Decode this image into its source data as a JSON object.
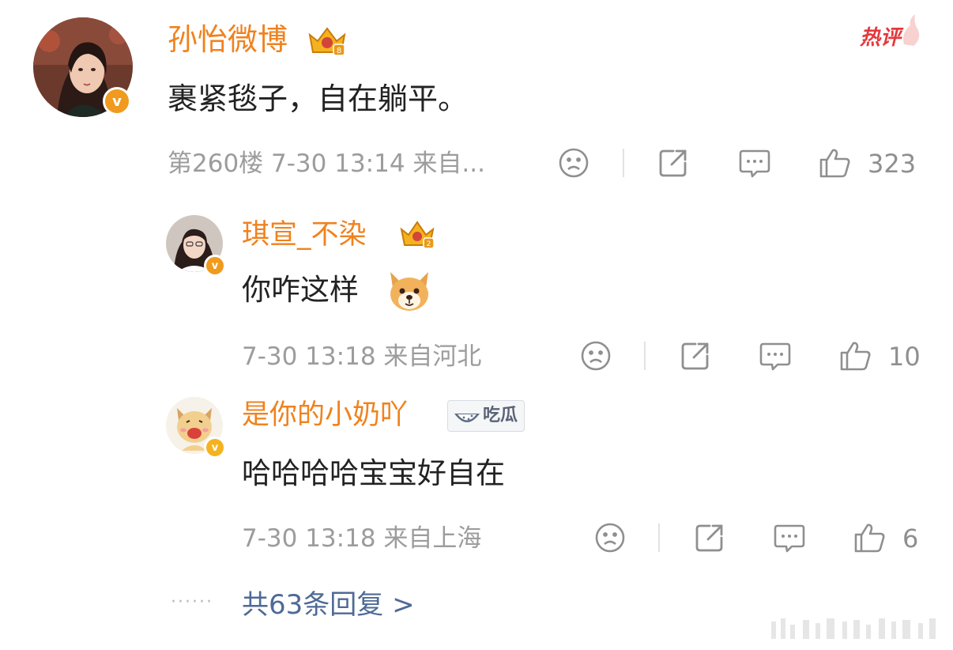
{
  "comment": {
    "author": "孙怡微博",
    "text": "裹紧毯子，自在躺平。",
    "meta": "第260楼 7-30 13:14 来自...",
    "likes": "323",
    "hot_label": "热评",
    "icons": [
      "crown-badge-icon",
      "sad-face-icon",
      "share-icon",
      "comment-icon",
      "thumbs-up-icon",
      "verified-badge-icon"
    ]
  },
  "replies": [
    {
      "author": "琪宣_不染",
      "text": "你咋这样",
      "emoji": "dog-face-emoji",
      "meta": "7-30 13:18 来自河北",
      "likes": "10"
    },
    {
      "author": "是你的小奶吖",
      "tag": "吃瓜",
      "tag_icon": "watermelon-icon",
      "text": "哈哈哈哈宝宝好自在",
      "meta": "7-30 13:18 来自上海",
      "likes": "6"
    }
  ],
  "more_replies": "共63条回复 >",
  "colors": {
    "name": "#f0821e",
    "meta": "#9c9c9c",
    "hot": "#e4393c",
    "link": "#4e6a96",
    "badge": "#f09a1e"
  }
}
